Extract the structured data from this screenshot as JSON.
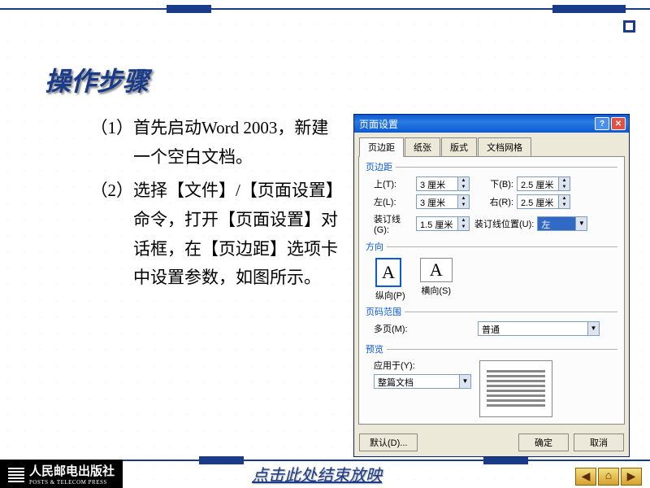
{
  "slide": {
    "title": "操作步骤",
    "steps": [
      "（1）首先启动Word 2003，新建一个空白文档。",
      "（2）选择【文件】/【页面设置】命令，打开【页面设置】对话框，在【页边距】选项卡中设置参数，如图所示。"
    ],
    "footer_link": "点击此处结束放映",
    "publisher": "人民邮电出版社",
    "publisher_sub": "POSTS & TELECOM PRESS"
  },
  "dialog": {
    "title": "页面设置",
    "tabs": [
      "页边距",
      "纸张",
      "版式",
      "文档网格"
    ],
    "groups": {
      "margins": "页边距",
      "orientation": "方向",
      "pages": "页码范围",
      "preview": "预览"
    },
    "fields": {
      "top_l": "上(T):",
      "top_v": "3 厘米",
      "bottom_l": "下(B):",
      "bottom_v": "2.5 厘米",
      "left_l": "左(L):",
      "left_v": "3 厘米",
      "right_l": "右(R):",
      "right_v": "2.5 厘米",
      "gutter_l": "装订线(G):",
      "gutter_v": "1.5 厘米",
      "gutter_pos_l": "装订线位置(U):",
      "gutter_pos_v": "左",
      "portrait": "纵向(P)",
      "landscape": "横向(S)",
      "multi_l": "多页(M):",
      "multi_v": "普通",
      "apply_l": "应用于(Y):",
      "apply_v": "整篇文档"
    },
    "buttons": {
      "default": "默认(D)...",
      "ok": "确定",
      "cancel": "取消"
    }
  },
  "nav": {
    "prev": "◀",
    "home": "⌂",
    "next": "▶"
  }
}
